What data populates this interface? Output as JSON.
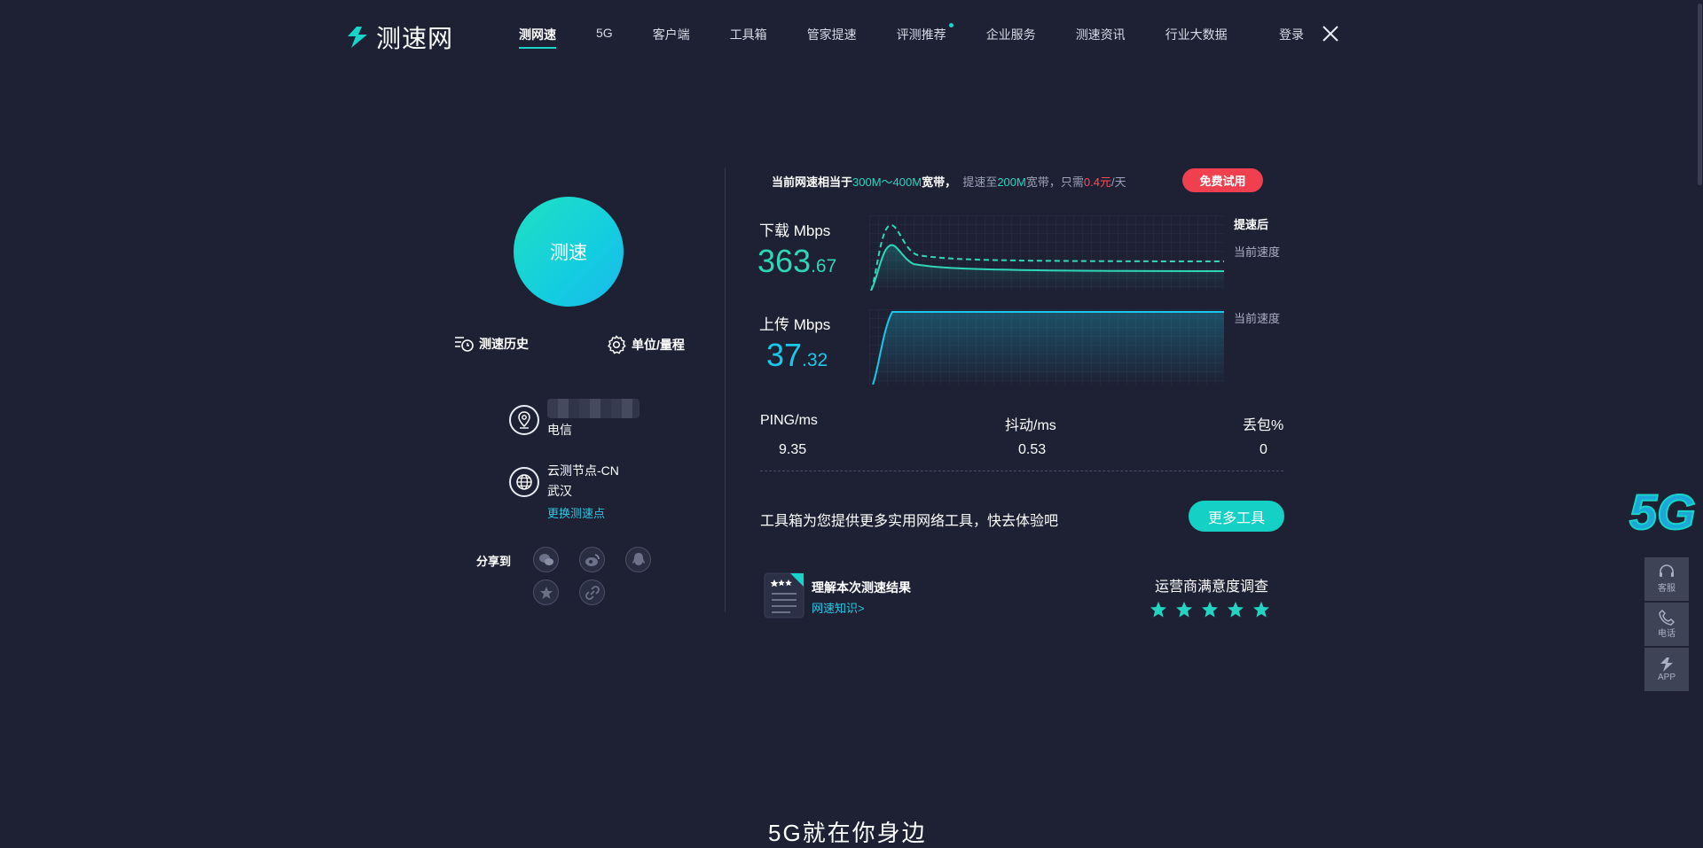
{
  "header": {
    "logo_text": "测速网",
    "nav": [
      {
        "label": "测网速",
        "active": true
      },
      {
        "label": "5G"
      },
      {
        "label": "客户端"
      },
      {
        "label": "工具箱"
      },
      {
        "label": "管家提速"
      },
      {
        "label": "评测推荐",
        "dot": true
      },
      {
        "label": "企业服务"
      },
      {
        "label": "测速资讯"
      },
      {
        "label": "行业大数据"
      }
    ],
    "login": "登录"
  },
  "left": {
    "speed_button": "测速",
    "history": "测速历史",
    "units": "单位/量程",
    "isp": "电信",
    "node_name": "云测节点-CN",
    "node_city": "武汉",
    "change_node": "更换测速点",
    "share_label": "分享到"
  },
  "promo": {
    "prefix": "当前网速相当于",
    "range": "300M～400M",
    "suffix": "宽带，",
    "upgrade_prefix": "提速至",
    "upgrade_speed": "200M",
    "upgrade_mid": "宽带，只需",
    "price": "0.4元",
    "per": "/天",
    "free_button": "免费试用"
  },
  "download": {
    "label": "下载 Mbps",
    "int": "363",
    "dec": ".67",
    "tag_after": "提速后",
    "tag_current": "当前速度"
  },
  "upload": {
    "label": "上传 Mbps",
    "int": "37",
    "dec": ".32",
    "tag_current": "当前速度"
  },
  "stats": {
    "ping_label": "PING/ms",
    "ping_value": "9.35",
    "jitter_label": "抖动/ms",
    "jitter_value": "0.53",
    "loss_label": "丢包%",
    "loss_value": "0"
  },
  "toolbox": {
    "text": "工具箱为您提供更多实用网络工具，快去体验吧",
    "button": "更多工具"
  },
  "result": {
    "title": "理解本次测速结果",
    "link": "网速知识>"
  },
  "survey": {
    "title": "运营商满意度调查",
    "stars": 5
  },
  "side": {
    "badge": "5G",
    "service": "客服",
    "phone": "电话",
    "app": "APP"
  },
  "bottom": {
    "heading": "5G就在你身边"
  },
  "colors": {
    "background": "#1e2134",
    "accent_teal": "#19d4c8",
    "accent_blue": "#27c9e6",
    "red": "#f0404f"
  }
}
